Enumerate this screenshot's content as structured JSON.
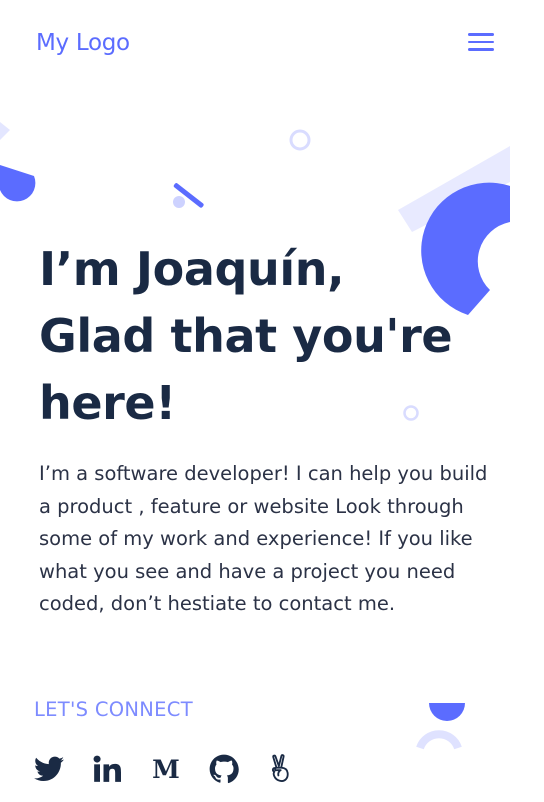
{
  "header": {
    "logo": "My Logo",
    "menu_icon": "hamburger-menu-icon"
  },
  "hero": {
    "title_line1": "I’m Joaquín,",
    "title_line2": "Glad that you're",
    "title_line3": "here!",
    "intro": "I’m a software developer! I can help you build a product , feature or website Look through some of my work and experience! If you like what you see and have a project you need coded, don’t hestiate to contact me."
  },
  "connect": {
    "label": "LET'S CONNECT",
    "links": [
      {
        "icon": "twitter-icon"
      },
      {
        "icon": "linkedin-icon"
      },
      {
        "icon": "medium-icon",
        "text": "M"
      },
      {
        "icon": "github-icon"
      },
      {
        "icon": "angellist-icon"
      }
    ]
  },
  "colors": {
    "accent": "#5b6cff",
    "accent_light": "#e7e9ff",
    "heading": "#1a2a44",
    "text": "#2b3246",
    "connect": "#7d8bff"
  }
}
